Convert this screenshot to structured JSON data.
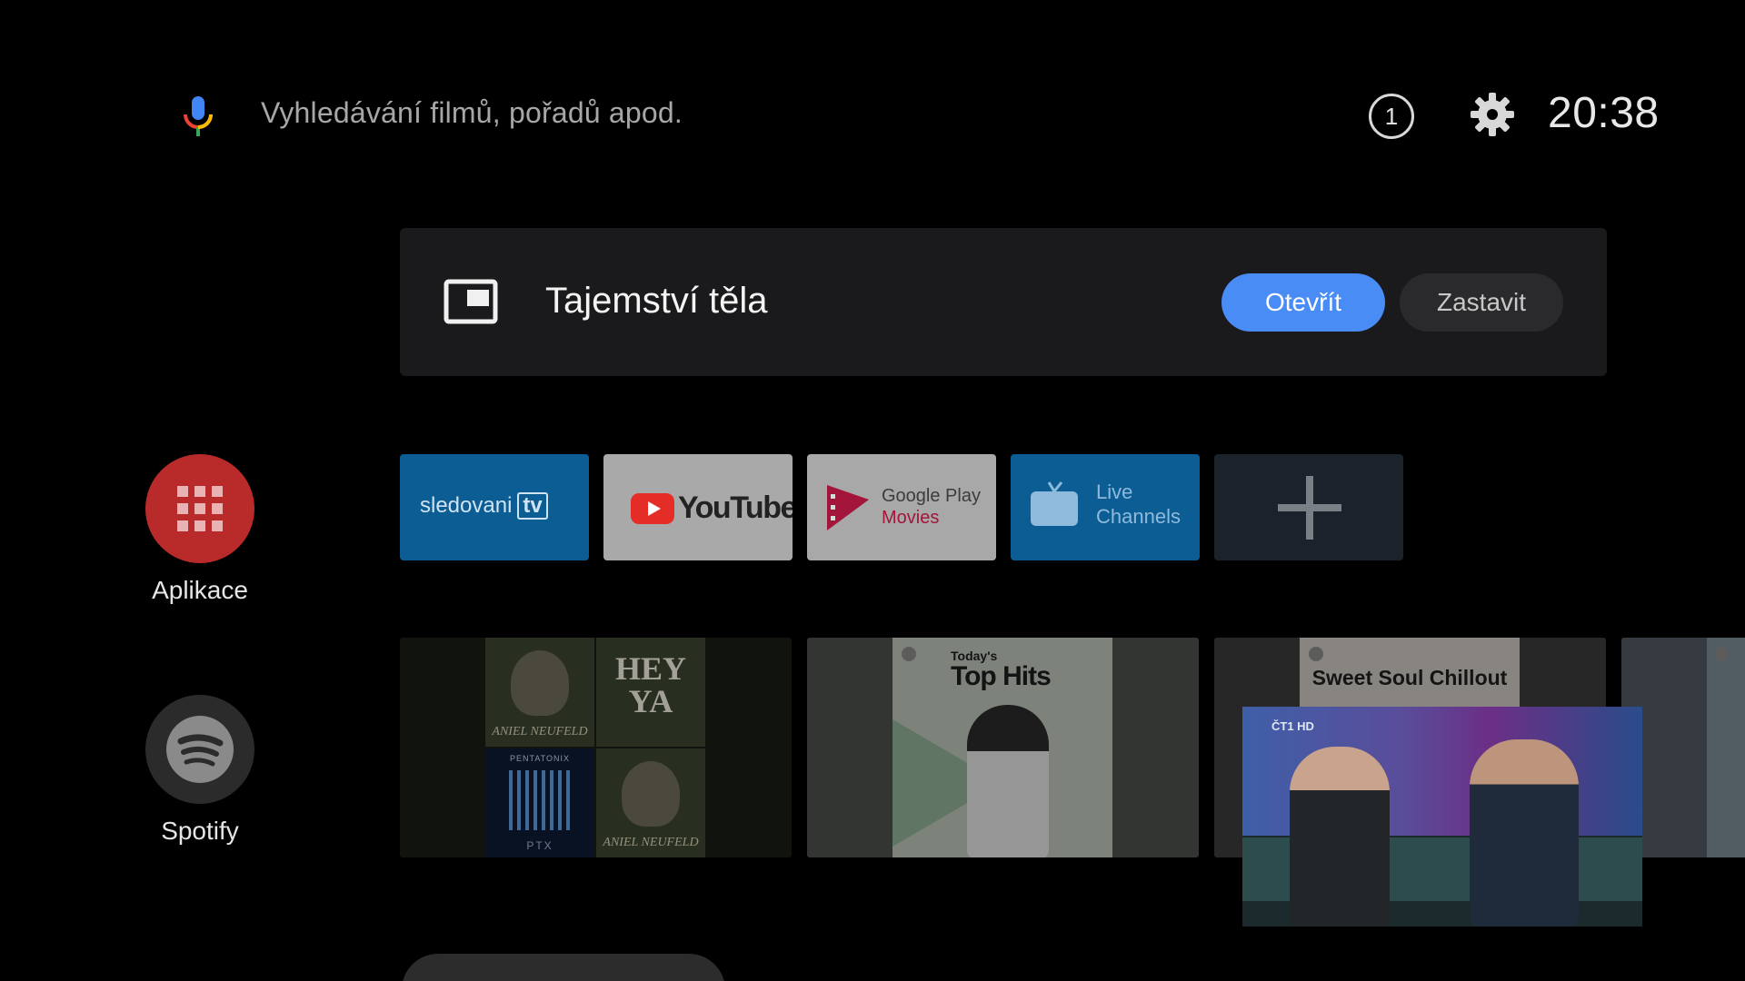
{
  "search": {
    "placeholder": "Vyhledávání filmů, pořadů apod."
  },
  "status": {
    "notification_count": "1",
    "time": "20:38"
  },
  "now_playing": {
    "title": "Tajemství těla",
    "open_label": "Otevřít",
    "stop_label": "Zastavit"
  },
  "rail": [
    {
      "label": "Aplikace",
      "icon": "apps-grid-icon",
      "color": "#b92a2a"
    },
    {
      "label": "Spotify",
      "icon": "spotify-icon",
      "color": "#2b2b2b"
    }
  ],
  "apps": {
    "sledovani": {
      "text": "sledovani",
      "badge": "tv"
    },
    "youtube": {
      "text": "YouTube"
    },
    "google_play": {
      "line1": "Google Play",
      "line2": "Movies"
    },
    "live_channels": {
      "line1": "Live",
      "line2": "Channels"
    }
  },
  "content": {
    "album_labels": [
      "ANIEL NEUFELD",
      "HEY YA",
      "PENTATONIX",
      "PTX",
      "ANIEL NEUFELD"
    ],
    "tth_small": "Today's",
    "tth_big": "Top Hits",
    "sweet": "Sweet Soul Chillout",
    "pip_logo": "ČT1 HD"
  },
  "colors": {
    "accent": "#4a8cf5",
    "background": "#000000",
    "card": "#1a1a1c"
  }
}
